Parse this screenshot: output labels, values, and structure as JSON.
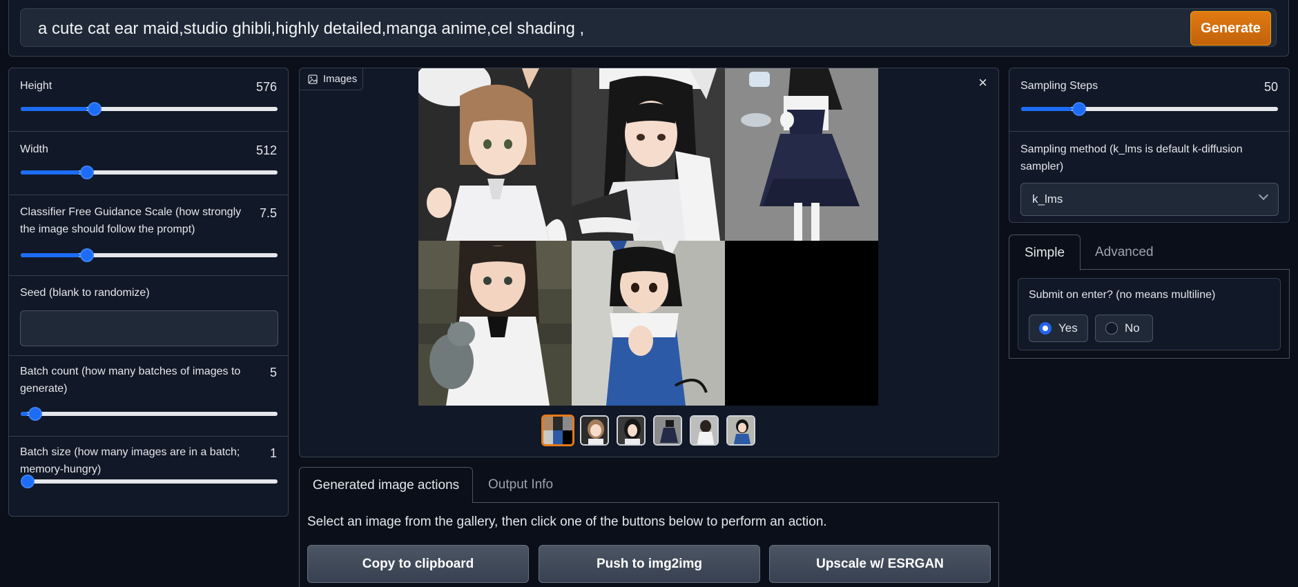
{
  "prompt": {
    "text": "a cute cat ear maid,studio ghibli,highly detailed,manga anime,cel shading ,",
    "generate_label": "Generate"
  },
  "left": {
    "height": {
      "label": "Height",
      "value": "576",
      "fraction": 0.26
    },
    "width": {
      "label": "Width",
      "value": "512",
      "fraction": 0.23
    },
    "cfg": {
      "label": "Classifier Free Guidance Scale (how strongly the image should follow the prompt)",
      "value": "7.5",
      "fraction": 0.23
    },
    "seed": {
      "label": "Seed (blank to randomize)",
      "value": ""
    },
    "batch_count": {
      "label": "Batch count (how many batches of images to generate)",
      "value": "5",
      "fraction": 0.03
    },
    "batch_size": {
      "label": "Batch size (how many images are in a batch; memory-hungry)",
      "value": "1",
      "fraction": 0.0
    }
  },
  "gallery": {
    "label": "Images",
    "close_glyph": "×",
    "thumb_count": 6
  },
  "actions": {
    "tabs": [
      "Generated image actions",
      "Output Info"
    ],
    "hint": "Select an image from the gallery, then click one of the buttons below to perform an action.",
    "buttons": [
      "Copy to clipboard",
      "Push to img2img",
      "Upscale w/ ESRGAN"
    ]
  },
  "right": {
    "steps": {
      "label": "Sampling Steps",
      "value": "50",
      "fraction": 0.2
    },
    "method": {
      "label": "Sampling method (k_lms is default k-diffusion sampler)",
      "value": "k_lms"
    },
    "tabs": [
      "Simple",
      "Advanced"
    ],
    "submit": {
      "label": "Submit on enter? (no means multiline)",
      "options": [
        "Yes",
        "No"
      ],
      "selected": "Yes"
    }
  },
  "colors": {
    "accent": "#1d6cf5",
    "generate": "#d56e10",
    "background": "#0b0f19"
  }
}
